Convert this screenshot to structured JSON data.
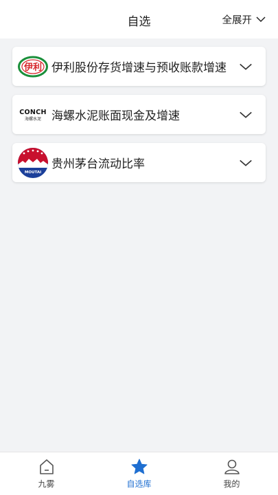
{
  "header": {
    "title": "自选",
    "expand_all_label": "全展开"
  },
  "cards": [
    {
      "title": "伊利股份存货增速与预收账款增速",
      "logo": "yili-logo",
      "logo_text": "伊利"
    },
    {
      "title": "海螺水泥账面现金及增速",
      "logo": "conch-logo",
      "logo_text": "CONCH",
      "logo_subtext": "海螺水泥"
    },
    {
      "title": "贵州茅台流动比率",
      "logo": "moutai-logo",
      "logo_text": "MOUTAI"
    }
  ],
  "tabs": [
    {
      "label": "九雾",
      "icon": "home-icon",
      "active": false
    },
    {
      "label": "自选库",
      "icon": "star-icon",
      "active": true
    },
    {
      "label": "我的",
      "icon": "user-icon",
      "active": false
    }
  ],
  "colors": {
    "accent": "#1f6fd1",
    "background": "#f2f3f5",
    "yili_green": "#1a8f3a",
    "yili_red": "#d6262b",
    "moutai_red": "#c8102e",
    "moutai_blue": "#1b3f9a"
  }
}
